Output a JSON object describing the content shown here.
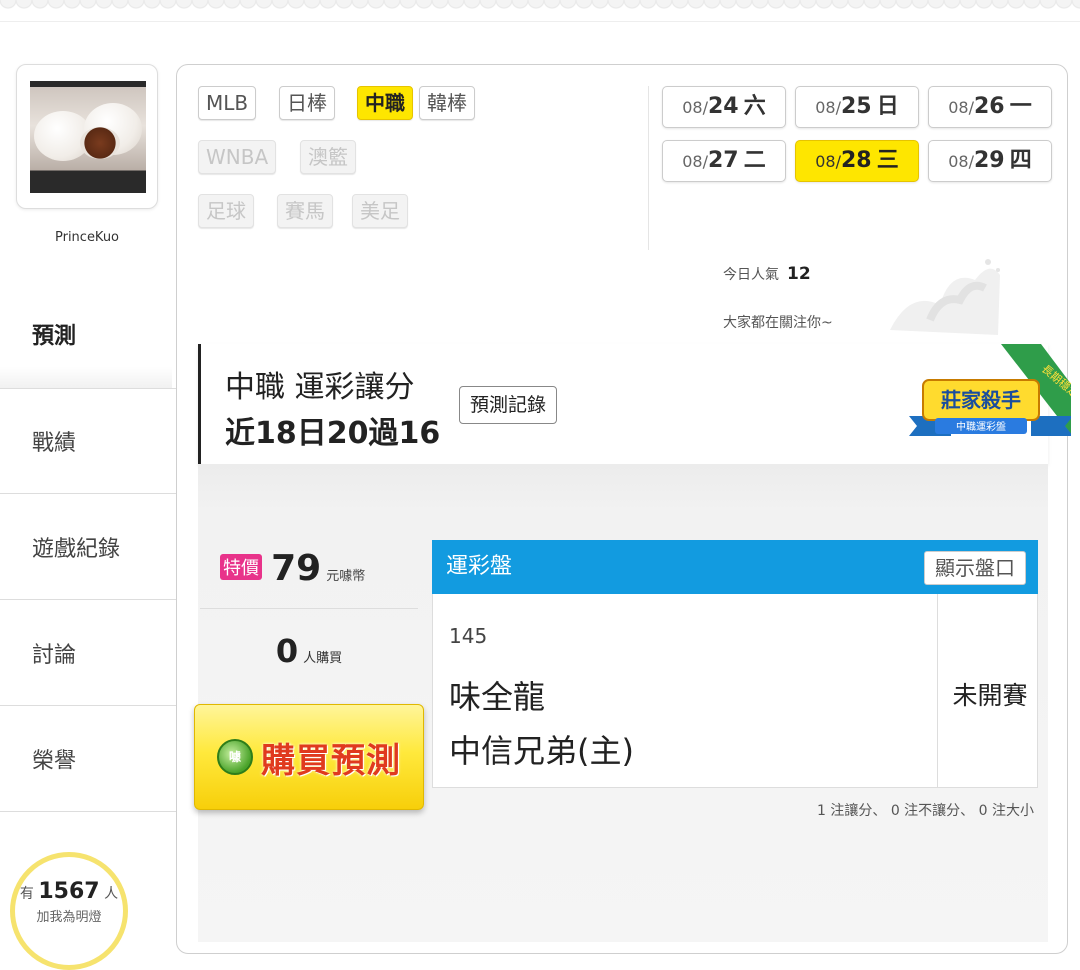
{
  "user": {
    "name": "PrinceKuo"
  },
  "sidebar": {
    "items": [
      {
        "label": "預測",
        "active": true
      },
      {
        "label": "戰績",
        "active": false
      },
      {
        "label": "遊戲紀錄",
        "active": false
      },
      {
        "label": "討論",
        "active": false
      },
      {
        "label": "榮譽",
        "active": false
      }
    ],
    "fans": {
      "prefix": "有",
      "count": "1567",
      "suffix": "人",
      "text": "加我為明燈"
    }
  },
  "leagues": {
    "row1": [
      "MLB",
      "日棒",
      "中職",
      "韓棒"
    ],
    "row2": [
      "WNBA",
      "澳籃"
    ],
    "row3": [
      "足球",
      "賽馬",
      "美足"
    ],
    "active": "中職"
  },
  "dates": [
    {
      "month": "08/",
      "day": "24",
      "weekday": "六"
    },
    {
      "month": "08/",
      "day": "25",
      "weekday": "日"
    },
    {
      "month": "08/",
      "day": "26",
      "weekday": "一"
    },
    {
      "month": "08/",
      "day": "27",
      "weekday": "二"
    },
    {
      "month": "08/",
      "day": "28",
      "weekday": "三",
      "active": true
    },
    {
      "month": "08/",
      "day": "29",
      "weekday": "四"
    }
  ],
  "popularity": {
    "label": "今日人氣",
    "value": "12",
    "message": "大家都在關注你~"
  },
  "title": {
    "line1": "中職 運彩讓分",
    "line2": "近18日20過16",
    "record_button": "預測記錄",
    "badge_main": "莊家殺手",
    "badge_sub": "中職運彩盤",
    "ribbon": "長期穩定"
  },
  "pricing": {
    "sale_tag": "特價",
    "price": "79",
    "price_unit": "元噱幣",
    "buyers": "0",
    "buyers_unit": "人購買",
    "buy_button": "購買預測",
    "buy_icon_text": "噱"
  },
  "odds": {
    "header": "運彩盤",
    "show_button": "顯示盤口",
    "game_id": "145",
    "away_team": "味全龍",
    "home_team": "中信兄弟(主)",
    "status": "未開賽",
    "summary": "1 注讓分、 0 注不讓分、 0 注大小"
  },
  "colors": {
    "accent_yellow": "#fee600",
    "odds_blue": "#129be0",
    "sale_pink": "#e8338a",
    "buy_text_red": "#e03a1e"
  }
}
